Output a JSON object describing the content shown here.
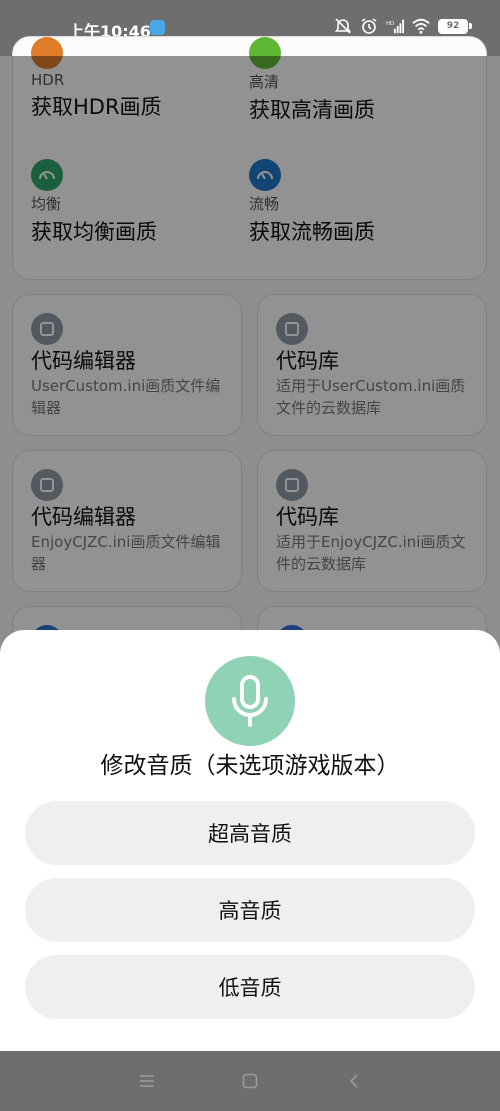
{
  "status_bar": {
    "time": "上午10:46",
    "battery": "92",
    "icons": [
      "app-notification-icon",
      "mute-icon",
      "alarm-icon",
      "hd-signal-icon",
      "wifi-icon",
      "battery-icon"
    ]
  },
  "quality_modes": [
    {
      "label": "HDR",
      "title": "获取HDR画质",
      "icon_color": "#e07b2a"
    },
    {
      "label": "高清",
      "title": "获取高清画质",
      "icon_color": "#5fb734"
    },
    {
      "label": "均衡",
      "title": "获取均衡画质",
      "icon_color": "#2fa56b"
    },
    {
      "label": "流畅",
      "title": "获取流畅画质",
      "icon_color": "#1f78c8"
    }
  ],
  "tools": [
    {
      "title": "代码编辑器",
      "desc": "UserCustom.ini画质文件编辑器"
    },
    {
      "title": "代码库",
      "desc": "适用于UserCustom.ini画质文件的云数据库"
    },
    {
      "title": "代码编辑器",
      "desc": "EnjoyCJZC.ini画质文件编辑器"
    },
    {
      "title": "代码库",
      "desc": "适用于EnjoyCJZC.ini画质文件的云数据库"
    }
  ],
  "sheet": {
    "title": "修改音质（未选项游戏版本）",
    "icon": "microphone-icon",
    "accent": "#8fd2b6",
    "options": [
      "超高音质",
      "高音质",
      "低音质"
    ]
  },
  "nav": [
    "menu-icon",
    "home-icon",
    "back-icon"
  ]
}
